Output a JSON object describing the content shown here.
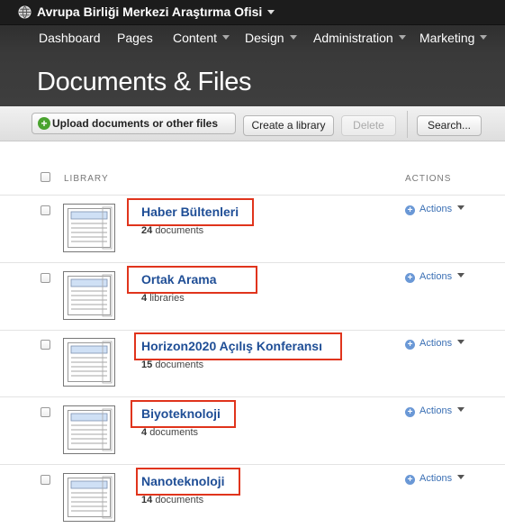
{
  "site": {
    "name": "Avrupa Birliği Merkezi Araştırma Ofisi"
  },
  "nav": [
    {
      "label": "Dashboard",
      "dropdown": false
    },
    {
      "label": "Pages",
      "dropdown": false
    },
    {
      "label": "Content",
      "dropdown": true
    },
    {
      "label": "Design",
      "dropdown": true
    },
    {
      "label": "Administration",
      "dropdown": true
    },
    {
      "label": "Marketing",
      "dropdown": true
    }
  ],
  "page": {
    "title": "Documents & Files"
  },
  "toolbar": {
    "upload_label": "Upload documents or other files",
    "create_label": "Create a library",
    "delete_label": "Delete",
    "search_label": "Search..."
  },
  "table": {
    "col_library": "LIBRARY",
    "col_actions": "ACTIONS"
  },
  "libraries": [
    {
      "name": "Haber Bültenleri",
      "count": "24",
      "unit": "documents",
      "actions": "Actions",
      "highlight": true
    },
    {
      "name": "Ortak Arama",
      "count": "4",
      "unit": "libraries",
      "actions": "Actions",
      "highlight": true
    },
    {
      "name": "Horizon2020 Açılış Konferansı",
      "count": "15",
      "unit": "documents",
      "actions": "Actions",
      "highlight": true
    },
    {
      "name": "Biyoteknoloji",
      "count": "4",
      "unit": "documents",
      "actions": "Actions",
      "highlight": true
    },
    {
      "name": "Nanoteknoloji",
      "count": "14",
      "unit": "documents",
      "actions": "Actions",
      "highlight": true
    }
  ],
  "colors": {
    "highlight_border": "#e0341c",
    "link": "#1f4e96",
    "header_bg": "#2b2b2b"
  }
}
